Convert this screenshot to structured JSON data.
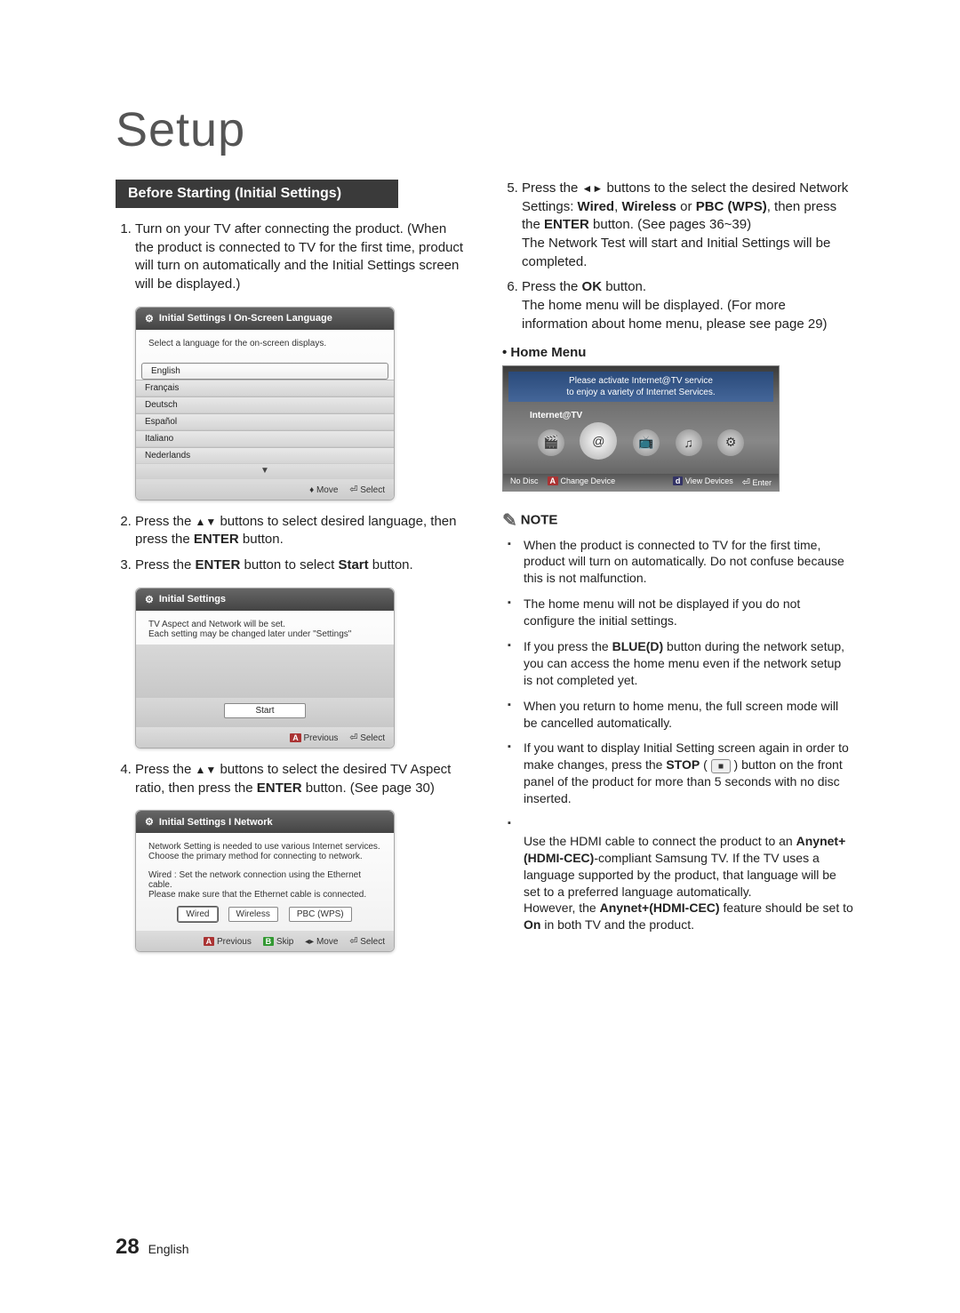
{
  "title": "Setup",
  "section_header": "Before Starting (Initial Settings)",
  "left_steps": {
    "s1": "Turn on your TV after connecting the product. (When the product is connected to TV for the first time, product will turn on automatically and the Initial Settings screen will be displayed.)",
    "s2_a": "Press the ",
    "s2_arrows": "▲▼",
    "s2_b": " buttons to select desired language, then press the ",
    "s2_enter": "ENTER",
    "s2_c": " button.",
    "s3_a": "Press the ",
    "s3_enter": "ENTER",
    "s3_b": " button to select ",
    "s3_start": "Start",
    "s3_c": " button.",
    "s4_a": "Press the ",
    "s4_arrows": "▲▼",
    "s4_b": " buttons to select the desired TV Aspect ratio, then press the ",
    "s4_enter": "ENTER",
    "s4_c": " button. (See page 30)"
  },
  "lang_box": {
    "title": "Initial Settings I On-Screen Language",
    "prompt": "Select a language for the on-screen displays.",
    "langs": [
      "English",
      "Français",
      "Deutsch",
      "Español",
      "Italiano",
      "Nederlands"
    ],
    "move": "Move",
    "select": "Select"
  },
  "start_box": {
    "title": "Initial Settings",
    "line1": "TV Aspect and Network will be set.",
    "line2": "Each setting may be changed later under \"Settings\"",
    "start": "Start",
    "prev": "Previous",
    "select": "Select"
  },
  "net_box": {
    "title": "Initial Settings I Network",
    "line1": "Network Setting is needed to use various Internet services.",
    "line2": "Choose the primary method for connecting to network.",
    "line3": "Wired : Set the network connection using the Ethernet cable.",
    "line4": "Please make sure that the Ethernet cable is connected.",
    "wired": "Wired",
    "wireless": "Wireless",
    "pbc": "PBC (WPS)",
    "prev": "Previous",
    "skip": "Skip",
    "move": "Move",
    "select": "Select"
  },
  "right_steps": {
    "s5_a": "Press the ",
    "s5_arrows": "◄►",
    "s5_b": " buttons to the select the desired Network Settings: ",
    "s5_wired": "Wired",
    "s5_sep1": ", ",
    "s5_wireless": "Wireless",
    "s5_sep2": " or ",
    "s5_pbc": "PBC (WPS)",
    "s5_c": ", then press the ",
    "s5_enter": "ENTER",
    "s5_d": " button. (See pages 36~39)\nThe Network Test will start and Initial Settings will be completed.",
    "s6_a": "Press the ",
    "s6_ok": "OK",
    "s6_b": " button.\nThe home menu will be displayed. (For more information about home menu, please see page 29)"
  },
  "home_menu_label": "Home Menu",
  "home_box": {
    "banner1": "Please activate Internet@TV service",
    "banner2": "to enjoy a variety of Internet Services.",
    "title": "Internet@TV",
    "nodisc": "No Disc",
    "change": "Change Device",
    "view": "View Devices",
    "enter": "Enter"
  },
  "note_label": "NOTE",
  "notes": {
    "n1": "When the product is connected to TV for the first time, product will turn on automatically. Do not confuse because this is not malfunction.",
    "n2": "The home menu will not be displayed if you do not configure the initial settings.",
    "n3_a": "If you press the ",
    "n3_blue": "BLUE(D)",
    "n3_b": " button during the network setup, you can access the home menu even if the network setup is not completed yet.",
    "n4": "When you return to home menu, the full screen mode will be cancelled automatically.",
    "n5_a": "If you want to display Initial Setting screen again in order to make changes, press the ",
    "n5_stop": "STOP",
    "n5_b": " button on the front panel of the product for more than 5 seconds with no disc inserted.",
    "n6_a": "Use the HDMI cable to connect the product to an ",
    "n6_any1": "Anynet+(HDMI-CEC)",
    "n6_b": "-compliant Samsung TV. If the TV uses a language supported by the product, that language will be set to a preferred language automatically.\nHowever, the ",
    "n6_any2": "Anynet+(HDMI-CEC)",
    "n6_c": " feature should be set to ",
    "n6_on": "On",
    "n6_d": " in both TV and the product."
  },
  "footer": {
    "num": "28",
    "lang": "English"
  },
  "badges": {
    "a": "A",
    "b": "B",
    "d": "d"
  }
}
